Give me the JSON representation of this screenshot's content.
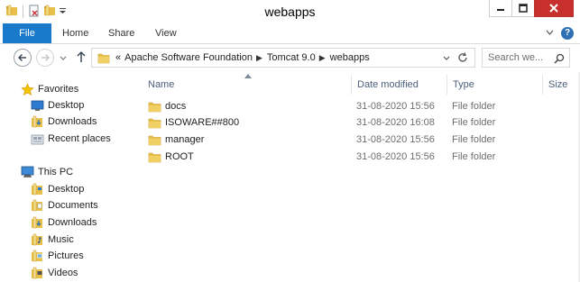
{
  "window": {
    "title": "webapps",
    "minimize_glyph": "—",
    "maximize_glyph": "□",
    "close_glyph": "✕"
  },
  "ribbon": {
    "tabs": [
      {
        "label": "File"
      },
      {
        "label": "Home"
      },
      {
        "label": "Share"
      },
      {
        "label": "View"
      }
    ],
    "help_glyph": "?",
    "expand_glyph": "∨",
    "accent": "#1979ca"
  },
  "address": {
    "overflow": "«",
    "crumbs": [
      "Apache Software Foundation",
      "Tomcat 9.0",
      "webapps"
    ],
    "separator": "▶"
  },
  "search": {
    "placeholder": "Search we..."
  },
  "navpane": {
    "favorites": {
      "label": "Favorites",
      "items": [
        {
          "label": "Desktop",
          "icon": "desktop-icon"
        },
        {
          "label": "Downloads",
          "icon": "downloads-folder-icon"
        },
        {
          "label": "Recent places",
          "icon": "recent-places-icon"
        }
      ]
    },
    "this_pc": {
      "label": "This PC",
      "items": [
        {
          "label": "Desktop",
          "icon": "folder-icon"
        },
        {
          "label": "Documents",
          "icon": "folder-icon"
        },
        {
          "label": "Downloads",
          "icon": "folder-icon"
        },
        {
          "label": "Music",
          "icon": "folder-icon"
        },
        {
          "label": "Pictures",
          "icon": "folder-icon"
        },
        {
          "label": "Videos",
          "icon": "folder-icon"
        }
      ]
    }
  },
  "filelist": {
    "columns": {
      "name": "Name",
      "date": "Date modified",
      "type": "Type",
      "size": "Size"
    },
    "rows": [
      {
        "name": "docs",
        "date": "31-08-2020 15:56",
        "type": "File folder"
      },
      {
        "name": "ISOWARE##800",
        "date": "31-08-2020 16:08",
        "type": "File folder"
      },
      {
        "name": "manager",
        "date": "31-08-2020 15:56",
        "type": "File folder"
      },
      {
        "name": "ROOT",
        "date": "31-08-2020 15:56",
        "type": "File folder"
      }
    ]
  },
  "colors": {
    "folder": "#e8c049",
    "folder_dark": "#c9982a",
    "header_text": "#4c607a",
    "close_button": "#c7302c"
  }
}
